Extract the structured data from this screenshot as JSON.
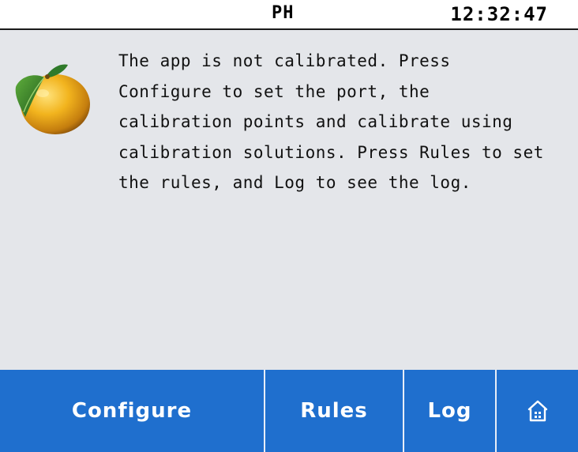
{
  "status_bar": {
    "title": "PH",
    "clock": "12:32:47"
  },
  "main": {
    "icon": "lemon-icon",
    "message_lines": [
      "The app is not calibrated. Press",
      "Configure to set the port, the",
      "calibration points and calibrate using",
      "calibration solutions. Press Rules to set",
      "the rules, and Log to see the log."
    ]
  },
  "toolbar": {
    "configure_label": "Configure",
    "rules_label": "Rules",
    "log_label": "Log",
    "home_icon": "home-icon"
  },
  "colors": {
    "background": "#e4e6ea",
    "toolbar": "#1f6fce",
    "lemon": "#f0b01c",
    "leaf": "#2f7a2a"
  }
}
